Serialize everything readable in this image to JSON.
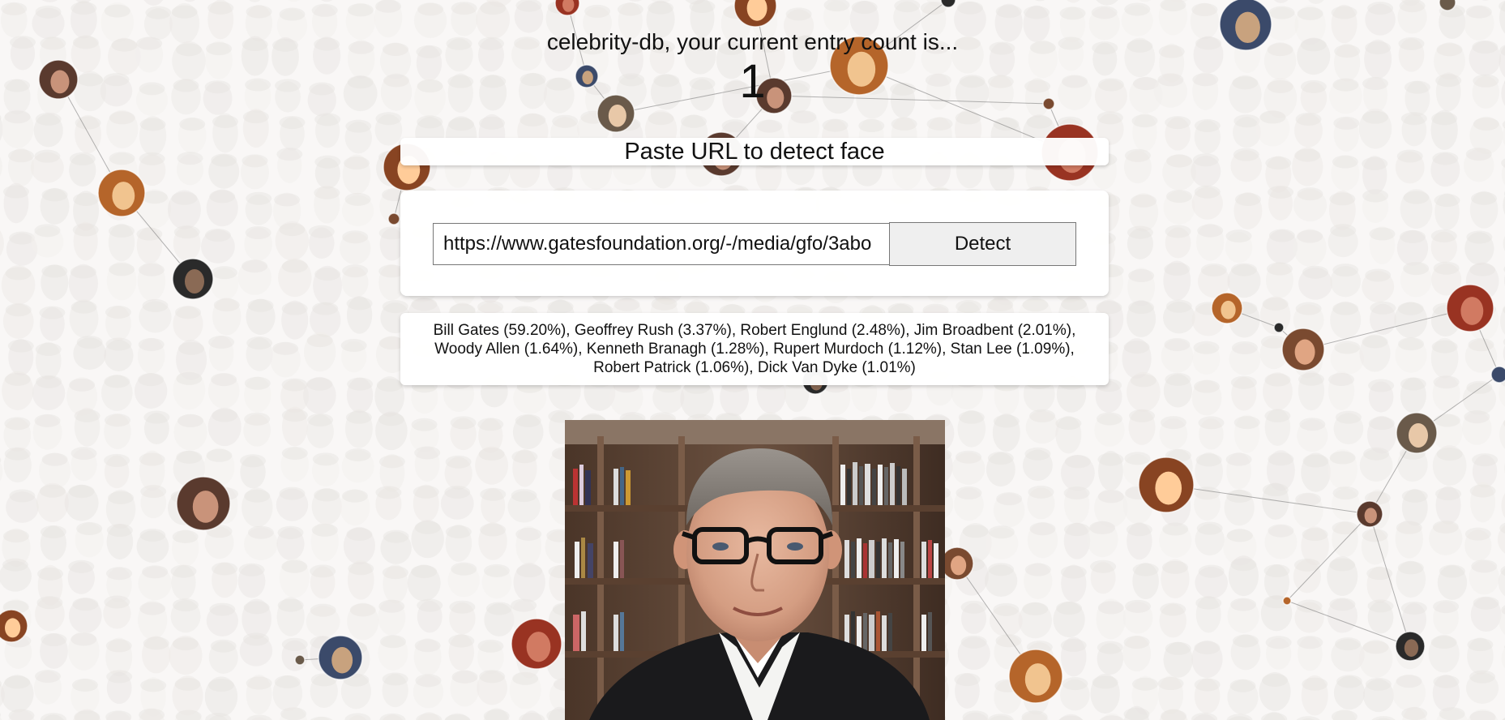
{
  "header": {
    "title": "celebrity-db, your current entry count is...",
    "count": "1"
  },
  "detect_panel": {
    "title": "Paste URL to detect face",
    "url_value": "https://www.gatesfoundation.org/-/media/gfo/3abo",
    "detect_label": "Detect"
  },
  "results": {
    "text": "Bill Gates (59.20%), Geoffrey Rush (3.37%), Robert Englund (2.48%), Jim Broadbent (2.01%), Woody Allen (1.64%), Kenneth Branagh (1.28%), Rupert Murdoch (1.12%), Stan Lee (1.09%), Robert Patrick (1.06%), Dick Van Dyke (1.01%)"
  },
  "colors": {
    "page_background": "#f2f0ee",
    "panel_background": "#ffffff",
    "button_background": "#efefef"
  }
}
